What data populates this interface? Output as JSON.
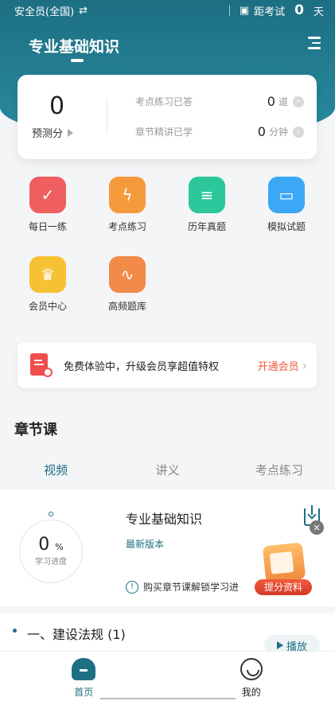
{
  "status_bar": {
    "exam_scope": "安全员(全国)",
    "exam_countdown_label": "距考试",
    "days_value": "0",
    "days_unit": "天"
  },
  "page": {
    "title": "专业基础知识"
  },
  "stats": {
    "predicted_score": "0",
    "predicted_label": "预测分",
    "points_practiced_label": "考点练习已答",
    "points_practiced_value": "0",
    "points_practiced_unit": "道",
    "chapter_study_label": "章节精讲已学",
    "chapter_study_value": "0",
    "chapter_study_unit": "分钟"
  },
  "features": [
    {
      "label": "每日一练",
      "icon": "calendar-check-icon",
      "color": "#ef5f5f"
    },
    {
      "label": "考点练习",
      "icon": "lightning-icon",
      "color": "#f59a3b"
    },
    {
      "label": "历年真题",
      "icon": "document-edit-icon",
      "color": "#2cc79b"
    },
    {
      "label": "模拟试题",
      "icon": "chart-screen-icon",
      "color": "#3ba7f5"
    },
    {
      "label": "会员中心",
      "icon": "crown-icon",
      "color": "#f7c135"
    },
    {
      "label": "高频题库",
      "icon": "wave-doc-icon",
      "color": "#f28a4a"
    }
  ],
  "promo": {
    "text": "免费体验中，升级会员享超值特权",
    "cta": "开通会员"
  },
  "section": {
    "title": "章节课"
  },
  "tabs": [
    {
      "label": "视频"
    },
    {
      "label": "讲义"
    },
    {
      "label": "考点练习"
    }
  ],
  "course": {
    "title": "专业基础知识",
    "version": "最新版本",
    "progress_value": "0",
    "progress_unit": "%",
    "progress_label": "学习进度",
    "unlock_text": "购买章节课解锁学习进"
  },
  "floating_promo": {
    "label": "提分资料",
    "close": "×"
  },
  "chapter": {
    "title": "一、建设法规 (1)",
    "play_label": "播放"
  },
  "bottom_nav": [
    {
      "label": "首页"
    },
    {
      "label": "我的"
    }
  ]
}
